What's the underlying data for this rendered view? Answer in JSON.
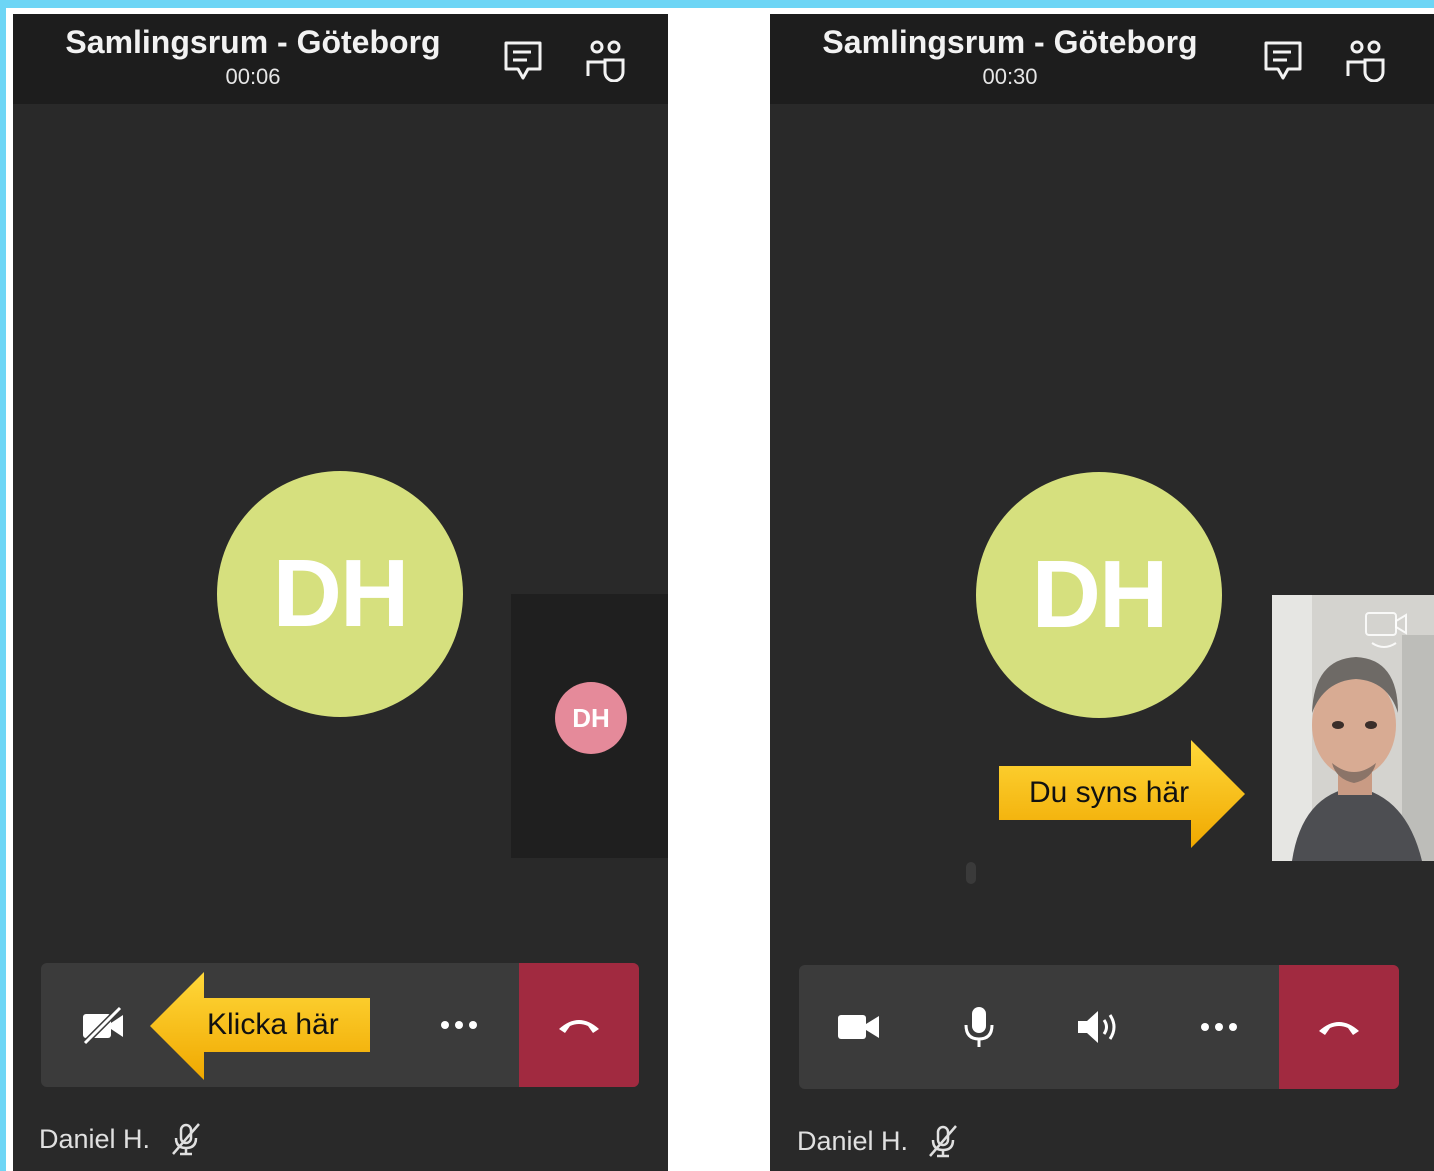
{
  "left_screen": {
    "title": "Samlingsrum - Göteborg",
    "timer": "00:06",
    "main_avatar": "DH",
    "self_avatar": "DH",
    "callout": "Klicka här",
    "participant_name": "Daniel H.",
    "controls": [
      "video-off-icon",
      "more-icon",
      "hangup-icon"
    ]
  },
  "right_screen": {
    "title": "Samlingsrum - Göteborg",
    "timer": "00:30",
    "main_avatar": "DH",
    "callout": "Du syns här",
    "participant_name": "Daniel H.",
    "controls": [
      "video-icon",
      "microphone-icon",
      "speaker-icon",
      "more-icon",
      "hangup-icon"
    ]
  },
  "colors": {
    "frame": "#6dd5f5",
    "background": "#292929",
    "top_bar": "#1d1d1d",
    "control_bar": "#3b3b3b",
    "hangup": "#a12a40",
    "main_avatar": "#d6e07e",
    "self_avatar": "#e58a9a",
    "callout": "#fcc300"
  }
}
